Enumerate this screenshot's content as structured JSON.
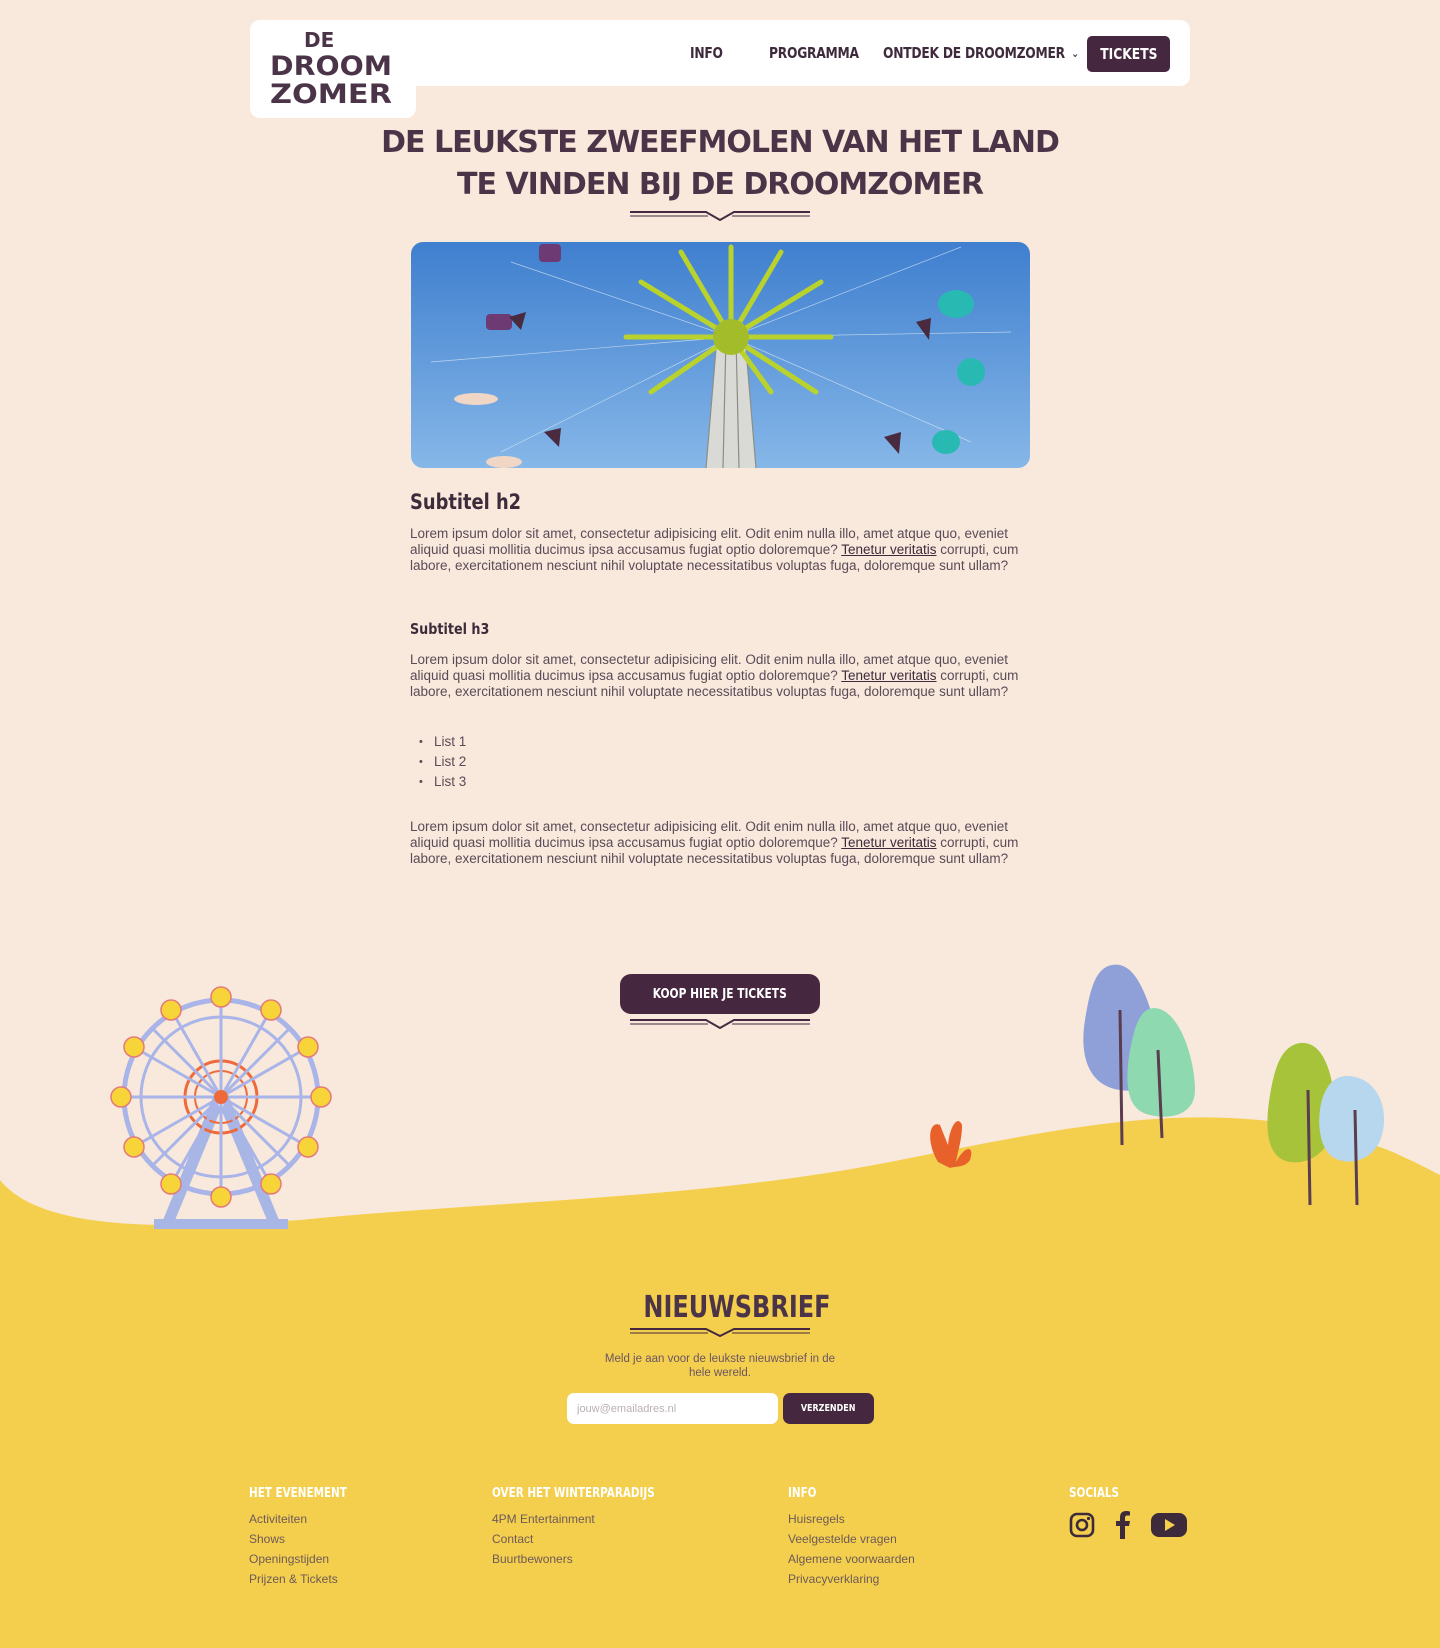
{
  "logo": {
    "text_line1": "DE",
    "text_line2": "DROOM",
    "text_line3": "ZOMER"
  },
  "nav": {
    "items": [
      {
        "label": "INFO"
      },
      {
        "label": "PROGRAMMA"
      },
      {
        "label": "ONTDEK DE DROOMZOMER"
      }
    ],
    "tickets_label": "TICKETS"
  },
  "page": {
    "title": "DE LEUKSTE ZWEEFMOLEN VAN HET LAND TE VINDEN BIJ DE DROOMZOMER"
  },
  "article": {
    "h2": "Subtitel h2",
    "p1_start": "Lorem ipsum dolor sit amet, consectetur adipisicing elit. Odit enim nulla illo, amet atque quo, eveniet aliquid quasi mollitia ducimus ipsa accusamus fugiat optio doloremque? ",
    "p1_link": "Tenetur veritatis",
    "p1_end": " corrupti, cum labore, exercitationem nesciunt nihil voluptate necessitatibus voluptas fuga, doloremque sunt ullam?",
    "h3": "Subtitel h3",
    "p2_start": "Lorem ipsum dolor sit amet, consectetur adipisicing elit. Odit enim nulla illo, amet atque quo, eveniet aliquid quasi mollitia ducimus ipsa accusamus fugiat optio doloremque? ",
    "p2_link": "Tenetur veritatis",
    "p2_end": " corrupti, cum labore, exercitationem nesciunt nihil voluptate necessitatibus voluptas fuga, doloremque sunt ullam?",
    "list": [
      "List 1",
      "List 2",
      "List 3"
    ],
    "p3_start": "Lorem ipsum dolor sit amet, consectetur adipisicing elit. Odit enim nulla illo, amet atque quo, eveniet aliquid quasi mollitia ducimus ipsa accusamus fugiat optio doloremque? ",
    "p3_link": "Tenetur veritatis",
    "p3_end": " corrupti, cum labore, exercitationem nesciunt nihil voluptate necessitatibus voluptas fuga, doloremque sunt ullam?"
  },
  "cta": {
    "label": "KOOP HIER JE TICKETS"
  },
  "newsletter": {
    "title": "NIEUWSBRIEF",
    "text": "Meld je aan voor de leukste nieuwsbrief in de hele wereld.",
    "placeholder": "jouw@emailadres.nl",
    "button": "VERZENDEN"
  },
  "footer": {
    "col1": {
      "heading": "HET EVENEMENT",
      "links": [
        "Activiteiten",
        "Shows",
        "Openingstijden",
        "Prijzen & Tickets"
      ]
    },
    "col2": {
      "heading": "OVER HET WINTERPARADIJS",
      "links": [
        "4PM Entertainment",
        "Contact",
        "Buurtbewoners"
      ]
    },
    "col3": {
      "heading": "INFO",
      "links": [
        "Huisregels",
        "Veelgestelde vragen",
        "Algemene voorwaarden",
        "Privacyverklaring"
      ]
    },
    "col4": {
      "heading": "SOCIALS",
      "icons": [
        "instagram-icon",
        "facebook-icon",
        "youtube-icon"
      ]
    }
  },
  "colors": {
    "background": "#f8e9dc",
    "primary": "#45283f",
    "footer_yellow": "#f4cf4e"
  }
}
